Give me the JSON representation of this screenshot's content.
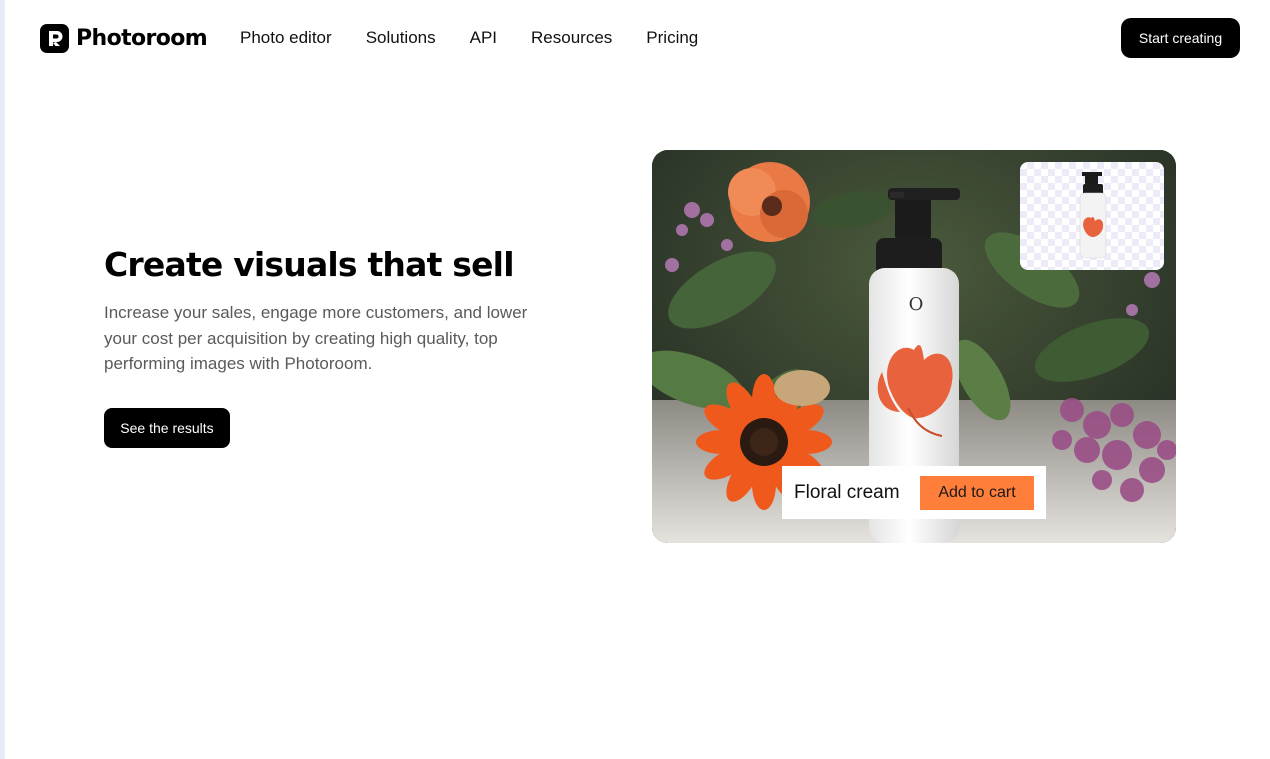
{
  "brand": {
    "name": "Photoroom",
    "logo_icon": "photoroom-logo-icon"
  },
  "nav": {
    "items": [
      {
        "label": "Photo editor"
      },
      {
        "label": "Solutions"
      },
      {
        "label": "API"
      },
      {
        "label": "Resources"
      },
      {
        "label": "Pricing"
      }
    ],
    "cta_label": "Start creating"
  },
  "hero": {
    "title": "Create visuals that sell",
    "body": "Increase your sales, engage more customers, and lower your cost per acquisition by creating high quality, top performing images with Photoroom.",
    "button_label": "See the results"
  },
  "showcase": {
    "product_name": "Floral cream",
    "add_to_cart_label": "Add to cart",
    "accent_color": "#ff7f3a",
    "bottle_emblem": "O"
  }
}
